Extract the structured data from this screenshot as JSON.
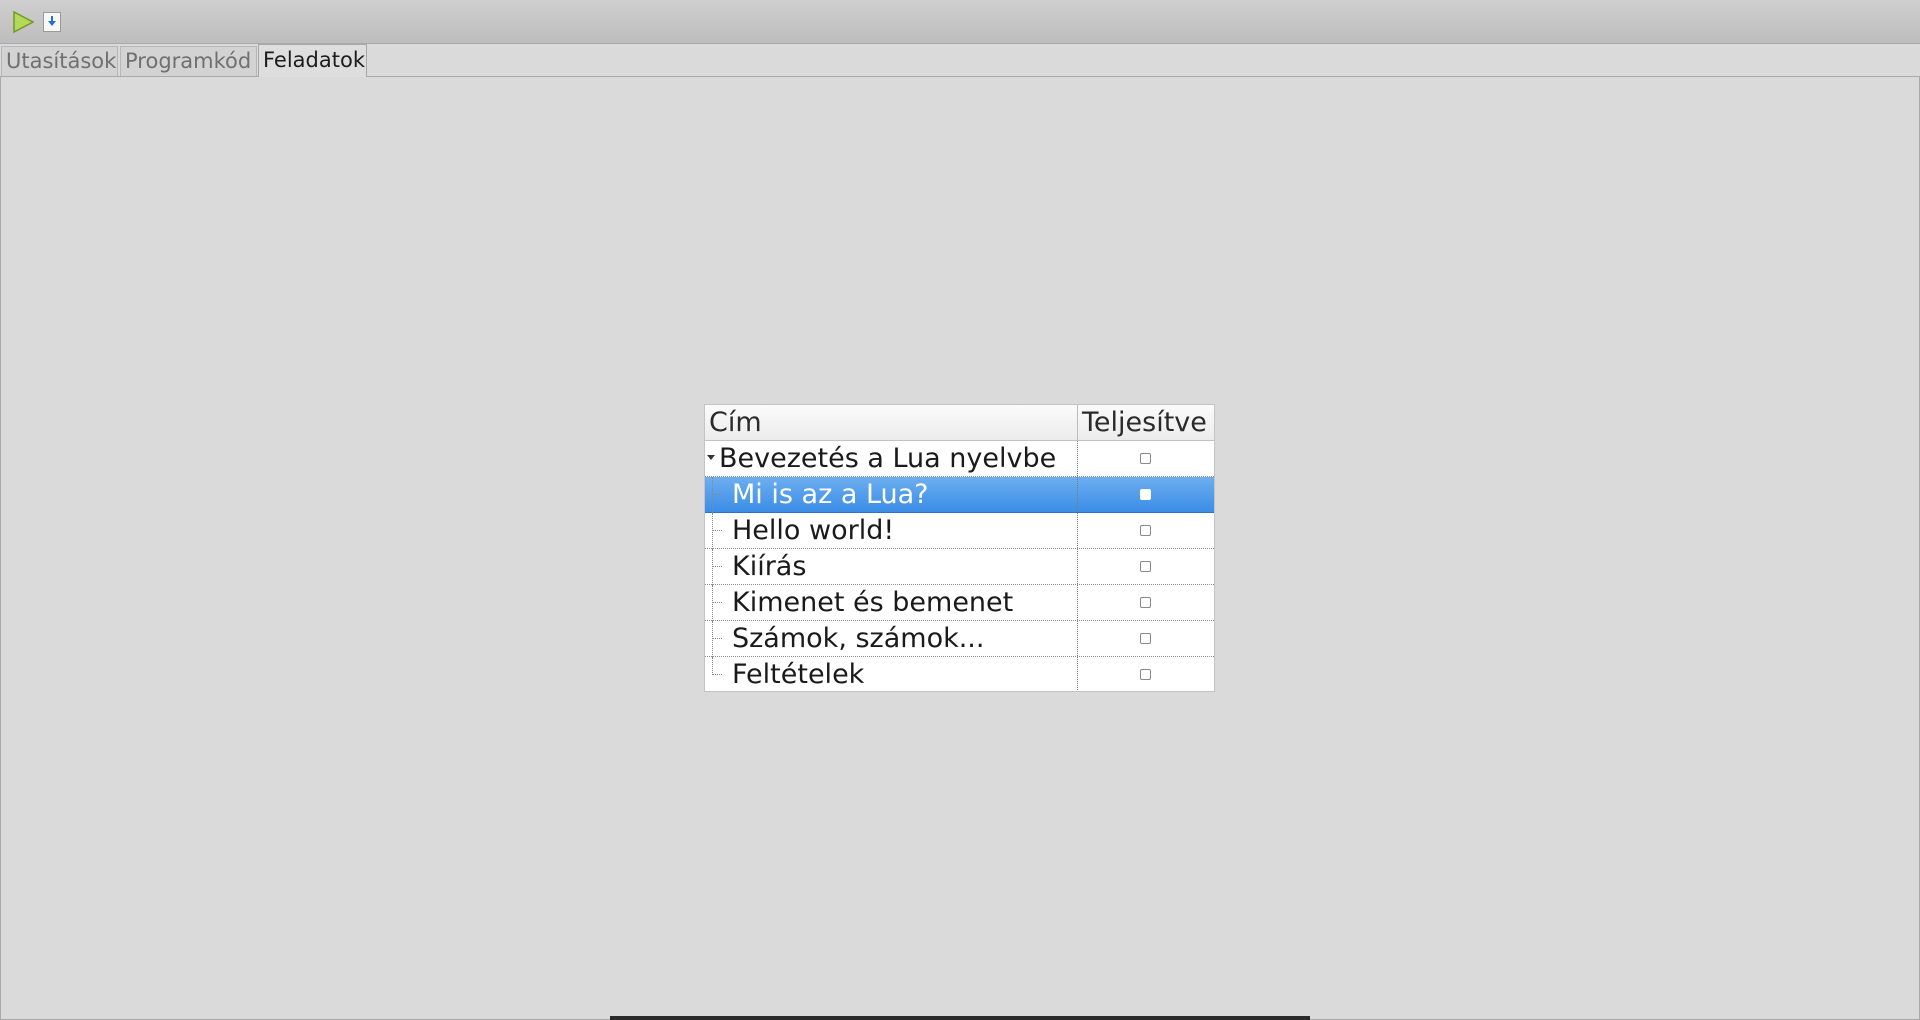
{
  "toolbar": {
    "run_icon": "play-icon",
    "download_icon": "download-arrow-icon",
    "run_color": "#8dc63f"
  },
  "tabs": [
    {
      "label": "Utasítások",
      "active": false
    },
    {
      "label": "Programkód",
      "active": false
    },
    {
      "label": "Feladatok",
      "active": true
    }
  ],
  "tree": {
    "columns": [
      "Cím",
      "Teljesítve"
    ],
    "parent": {
      "title": "Bevezetés a Lua nyelvbe",
      "expanded": true,
      "done": false
    },
    "children": [
      {
        "title": "Mi is az a Lua?",
        "done": false,
        "selected": true
      },
      {
        "title": "Hello world!",
        "done": false,
        "selected": false
      },
      {
        "title": "Kiírás",
        "done": false,
        "selected": false
      },
      {
        "title": "Kimenet és bemenet",
        "done": false,
        "selected": false
      },
      {
        "title": "Számok, számok...",
        "done": false,
        "selected": false
      },
      {
        "title": "Feltételek",
        "done": false,
        "selected": false
      }
    ],
    "selection_color": "#3b8de6"
  }
}
